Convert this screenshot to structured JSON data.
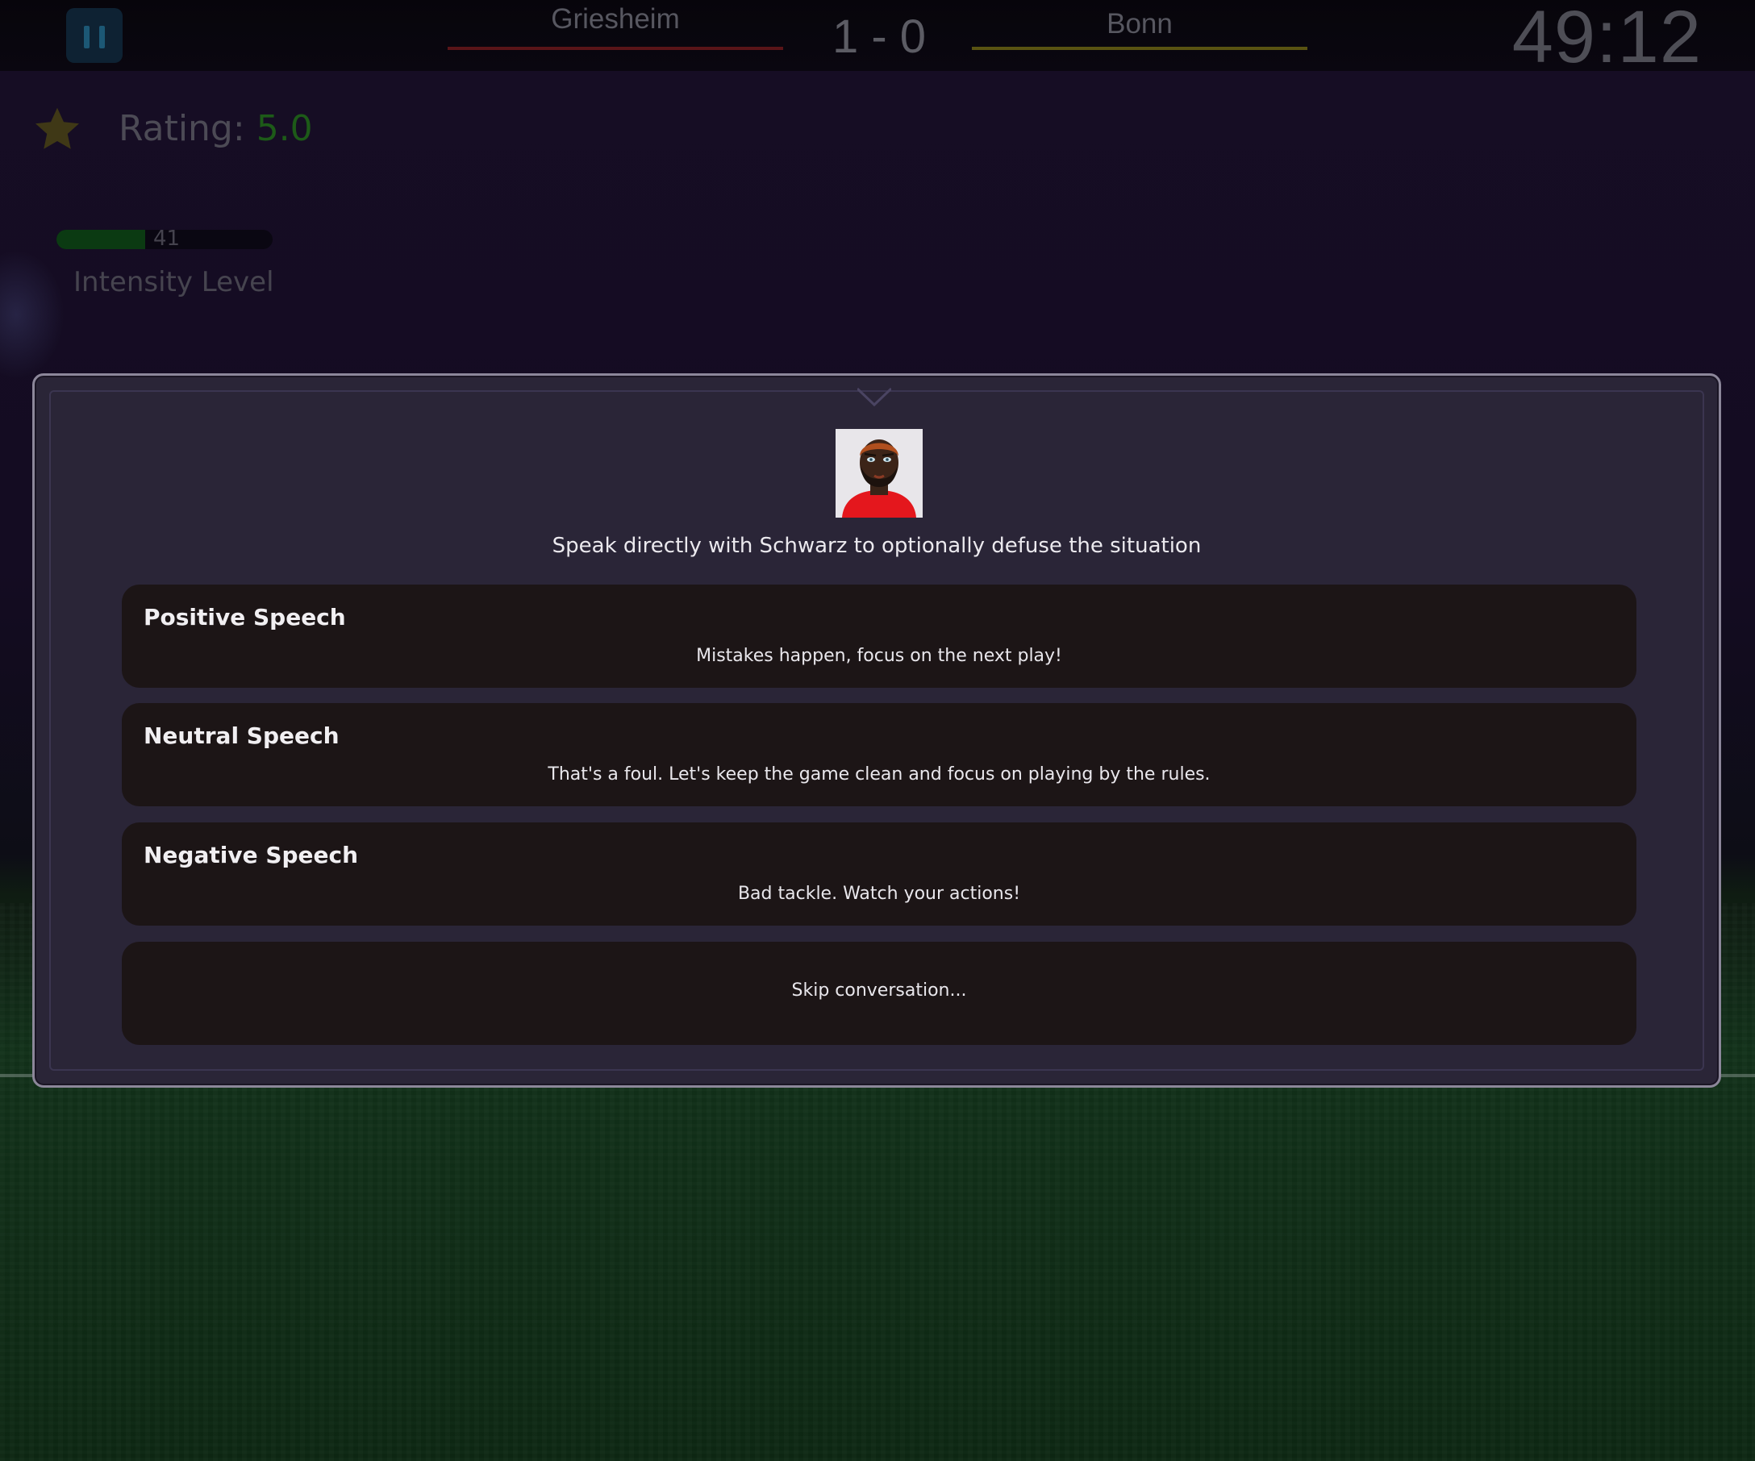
{
  "match": {
    "home_team": "Griesheim",
    "away_team": "Bonn",
    "score": "1 - 0",
    "clock": "49:12",
    "home_color": "#5a1418",
    "away_color": "#5a5312"
  },
  "hud": {
    "rating_label": "Rating:",
    "rating_value": "5.0",
    "intensity_value": "41",
    "intensity_fraction": 0.41,
    "intensity_label": "Intensity Level"
  },
  "dialog": {
    "prompt": "Speak directly with Schwarz to optionally defuse the situation",
    "options": [
      {
        "title": "Positive Speech",
        "text": "Mistakes happen, focus on the next play!"
      },
      {
        "title": "Neutral Speech",
        "text": "That's a foul. Let's keep the game clean and focus on playing by the rules."
      },
      {
        "title": "Negative Speech",
        "text": "Bad tackle. Watch your actions!"
      }
    ],
    "skip_label": "Skip conversation..."
  },
  "icons": [
    "pause-icon",
    "star-icon",
    "player-portrait"
  ]
}
